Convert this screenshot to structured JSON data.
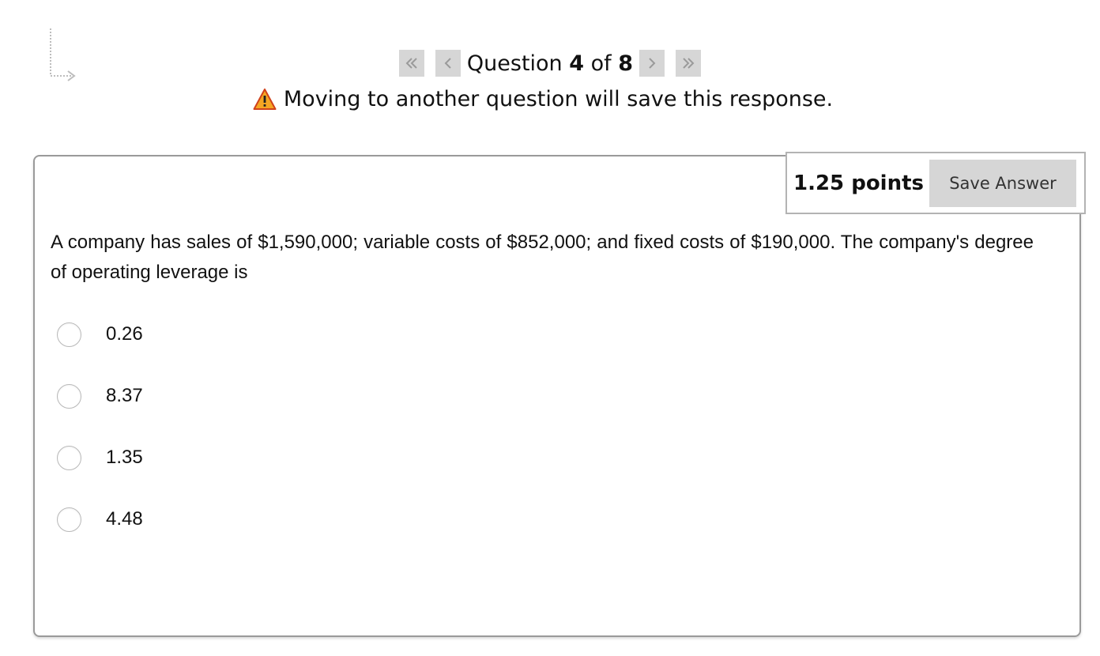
{
  "navigation": {
    "first_icon": "double-chevron-left-icon",
    "prev_icon": "chevron-left-icon",
    "next_icon": "chevron-right-icon",
    "last_icon": "double-chevron-right-icon",
    "label_prefix": "Question",
    "current": "4",
    "label_of": "of",
    "total": "8"
  },
  "warning": {
    "icon": "warning-triangle-icon",
    "text": "Moving to another question will save this response."
  },
  "question": {
    "points": "1.25 points",
    "save_label": "Save Answer",
    "text": "A company has sales of $1,590,000; variable costs of $852,000; and fixed costs of $190,000. The company's degree of operating leverage is",
    "options": [
      {
        "label": "0.26",
        "selected": false
      },
      {
        "label": "8.37",
        "selected": false
      },
      {
        "label": "1.35",
        "selected": false
      },
      {
        "label": "4.48",
        "selected": false
      }
    ]
  },
  "colors": {
    "nav_button_bg": "#d6d6d6",
    "card_border": "#9a9a9a",
    "warning_fill": "#f5a623"
  }
}
